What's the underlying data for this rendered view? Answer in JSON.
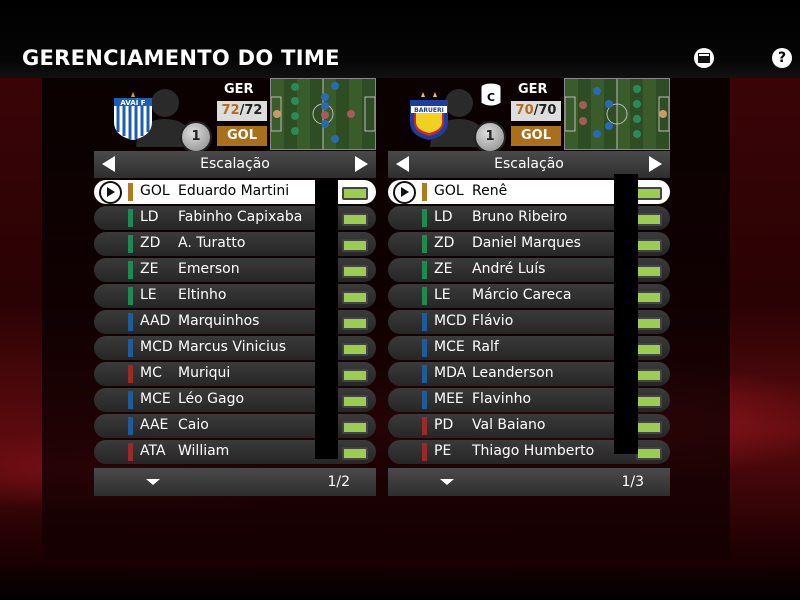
{
  "title": "GERENCIAMENTO DO TIME",
  "header_icons": {
    "left": "window-icon",
    "right_label": "?"
  },
  "colors": {
    "gk": "#b07a1e",
    "def": "#1e8a50",
    "mid": "#1f5a99",
    "att": "#9a2a2a",
    "condition": "#9acd50",
    "pos_badge": "#a8701b"
  },
  "left_team": {
    "crest_text": "AVAÍ F",
    "rank": "1",
    "ger_label": "GER",
    "rating_current": "72",
    "rating_sep": "/",
    "rating_max": "72",
    "position": "GOL",
    "lineup_label": "Escalação",
    "page": "1/2",
    "players": [
      {
        "pos": "GOL",
        "name": "Eduardo Martini",
        "group": "gk"
      },
      {
        "pos": "LD",
        "name": "Fabinho Capixaba",
        "group": "def"
      },
      {
        "pos": "ZD",
        "name": "A. Turatto",
        "group": "def"
      },
      {
        "pos": "ZE",
        "name": "Emerson",
        "group": "def"
      },
      {
        "pos": "LE",
        "name": "Eltinho",
        "group": "def"
      },
      {
        "pos": "AAD",
        "name": "Marquinhos",
        "group": "mid"
      },
      {
        "pos": "MCD",
        "name": "Marcus Vinicius",
        "group": "mid"
      },
      {
        "pos": "MC",
        "name": "Muriqui",
        "group": "att"
      },
      {
        "pos": "MCE",
        "name": "Léo Gago",
        "group": "mid"
      },
      {
        "pos": "AAE",
        "name": "Caio",
        "group": "mid"
      },
      {
        "pos": "ATA",
        "name": "William",
        "group": "att"
      }
    ]
  },
  "right_team": {
    "crest_text": "BARUERI",
    "captain_label": "C",
    "rank": "1",
    "ger_label": "GER",
    "rating_current": "70",
    "rating_sep": "/",
    "rating_max": "70",
    "position": "GOL",
    "lineup_label": "Escalação",
    "page": "1/3",
    "players": [
      {
        "pos": "GOL",
        "name": "Renê",
        "group": "gk"
      },
      {
        "pos": "LD",
        "name": "Bruno Ribeiro",
        "group": "def"
      },
      {
        "pos": "ZD",
        "name": "Daniel Marques",
        "group": "def"
      },
      {
        "pos": "ZE",
        "name": "André Luís",
        "group": "def"
      },
      {
        "pos": "LE",
        "name": "Márcio Careca",
        "group": "def"
      },
      {
        "pos": "MCD",
        "name": "Flávio",
        "group": "mid"
      },
      {
        "pos": "MCE",
        "name": "Ralf",
        "group": "mid"
      },
      {
        "pos": "MDA",
        "name": "Leanderson",
        "group": "mid"
      },
      {
        "pos": "MEE",
        "name": "Flavinho",
        "group": "mid"
      },
      {
        "pos": "PD",
        "name": "Val Baiano",
        "group": "att"
      },
      {
        "pos": "PE",
        "name": "Thiago Humberto",
        "group": "att"
      }
    ]
  }
}
